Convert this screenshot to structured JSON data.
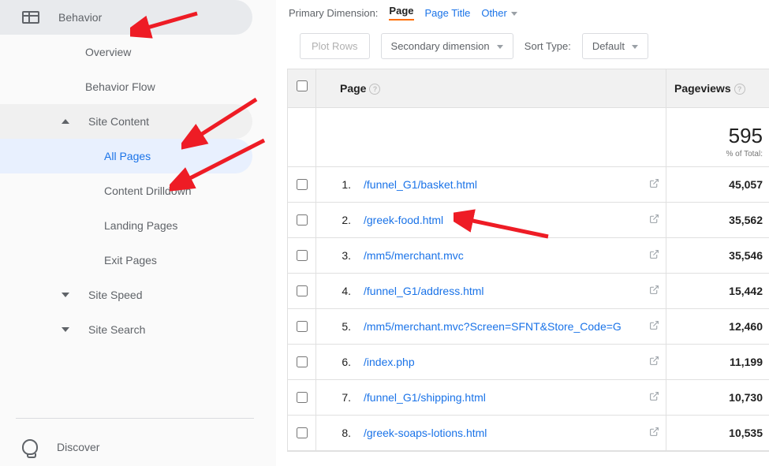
{
  "sidebar": {
    "header": "Behavior",
    "items": [
      {
        "label": "Overview",
        "type": "sub"
      },
      {
        "label": "Behavior Flow",
        "type": "sub"
      },
      {
        "label": "Site Content",
        "type": "expand",
        "open": true
      },
      {
        "label": "All Pages",
        "type": "subsub",
        "selected": true
      },
      {
        "label": "Content Drilldown",
        "type": "subsub"
      },
      {
        "label": "Landing Pages",
        "type": "subsub"
      },
      {
        "label": "Exit Pages",
        "type": "subsub"
      },
      {
        "label": "Site Speed",
        "type": "expand",
        "open": false
      },
      {
        "label": "Site Search",
        "type": "expand",
        "open": false
      }
    ],
    "discover": "Discover"
  },
  "toolbar": {
    "primary_dim_label": "Primary Dimension:",
    "dim_active": "Page",
    "dim_options": [
      "Page Title",
      "Other"
    ],
    "plot_rows": "Plot Rows",
    "secondary_dim": "Secondary dimension",
    "sort_type": "Sort Type:",
    "default": "Default"
  },
  "table": {
    "col_page": "Page",
    "col_pv": "Pageviews",
    "summary_value": "595",
    "summary_pct": "% of Total:",
    "rows": [
      {
        "n": "1.",
        "page": "/funnel_G1/basket.html",
        "pv": "45,057"
      },
      {
        "n": "2.",
        "page": "/greek-food.html",
        "pv": "35,562"
      },
      {
        "n": "3.",
        "page": "/mm5/merchant.mvc",
        "pv": "35,546"
      },
      {
        "n": "4.",
        "page": "/funnel_G1/address.html",
        "pv": "15,442"
      },
      {
        "n": "5.",
        "page": "/mm5/merchant.mvc?Screen=SFNT&Store_Code=G",
        "pv": "12,460"
      },
      {
        "n": "6.",
        "page": "/index.php",
        "pv": "11,199"
      },
      {
        "n": "7.",
        "page": "/funnel_G1/shipping.html",
        "pv": "10,730"
      },
      {
        "n": "8.",
        "page": "/greek-soaps-lotions.html",
        "pv": "10,535"
      }
    ]
  }
}
